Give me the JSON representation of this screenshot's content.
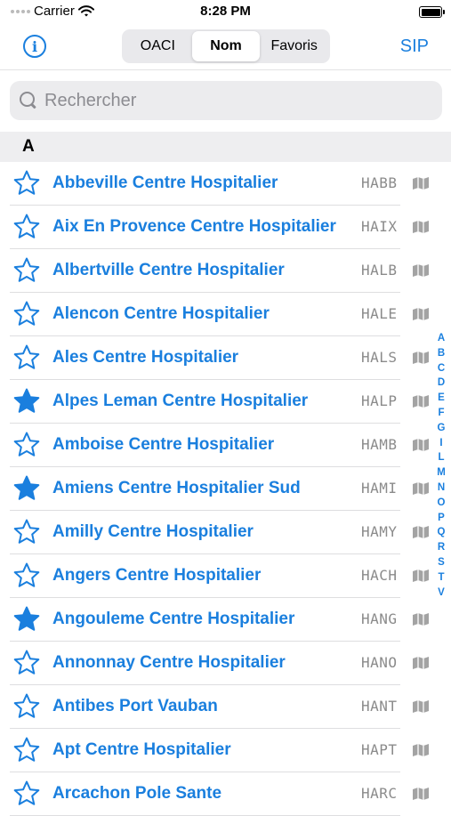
{
  "status": {
    "carrier": "Carrier",
    "time": "8:28 PM"
  },
  "nav": {
    "segments": [
      "OACI",
      "Nom",
      "Favoris"
    ],
    "active_segment": "Nom",
    "right_label": "SIP"
  },
  "search": {
    "placeholder": "Rechercher"
  },
  "section": "A",
  "rows": [
    {
      "name": "Abbeville Centre Hospitalier",
      "code": "HABB",
      "favorite": false
    },
    {
      "name": "Aix En Provence Centre Hospitalier",
      "code": "HAIX",
      "favorite": false
    },
    {
      "name": "Albertville Centre Hospitalier",
      "code": "HALB",
      "favorite": false
    },
    {
      "name": "Alencon Centre Hospitalier",
      "code": "HALE",
      "favorite": false
    },
    {
      "name": "Ales Centre Hospitalier",
      "code": "HALS",
      "favorite": false
    },
    {
      "name": "Alpes Leman Centre Hospitalier",
      "code": "HALP",
      "favorite": true
    },
    {
      "name": "Amboise Centre Hospitalier",
      "code": "HAMB",
      "favorite": false
    },
    {
      "name": "Amiens Centre Hospitalier Sud",
      "code": "HAMI",
      "favorite": true
    },
    {
      "name": "Amilly Centre Hospitalier",
      "code": "HAMY",
      "favorite": false
    },
    {
      "name": "Angers Centre Hospitalier",
      "code": "HACH",
      "favorite": false
    },
    {
      "name": "Angouleme Centre Hospitalier",
      "code": "HANG",
      "favorite": true
    },
    {
      "name": "Annonnay Centre Hospitalier",
      "code": "HANO",
      "favorite": false
    },
    {
      "name": "Antibes Port Vauban",
      "code": "HANT",
      "favorite": false
    },
    {
      "name": "Apt Centre Hospitalier",
      "code": "HAPT",
      "favorite": false
    },
    {
      "name": "Arcachon Pole Sante",
      "code": "HARC",
      "favorite": false
    }
  ],
  "index_letters": [
    "A",
    "B",
    "C",
    "D",
    "E",
    "F",
    "G",
    "I",
    "L",
    "M",
    "N",
    "O",
    "P",
    "Q",
    "R",
    "S",
    "T",
    "V"
  ],
  "colors": {
    "accent": "#1a7fde",
    "code_gray": "#8b8b8b",
    "map_icon": "#a3a3a3"
  }
}
